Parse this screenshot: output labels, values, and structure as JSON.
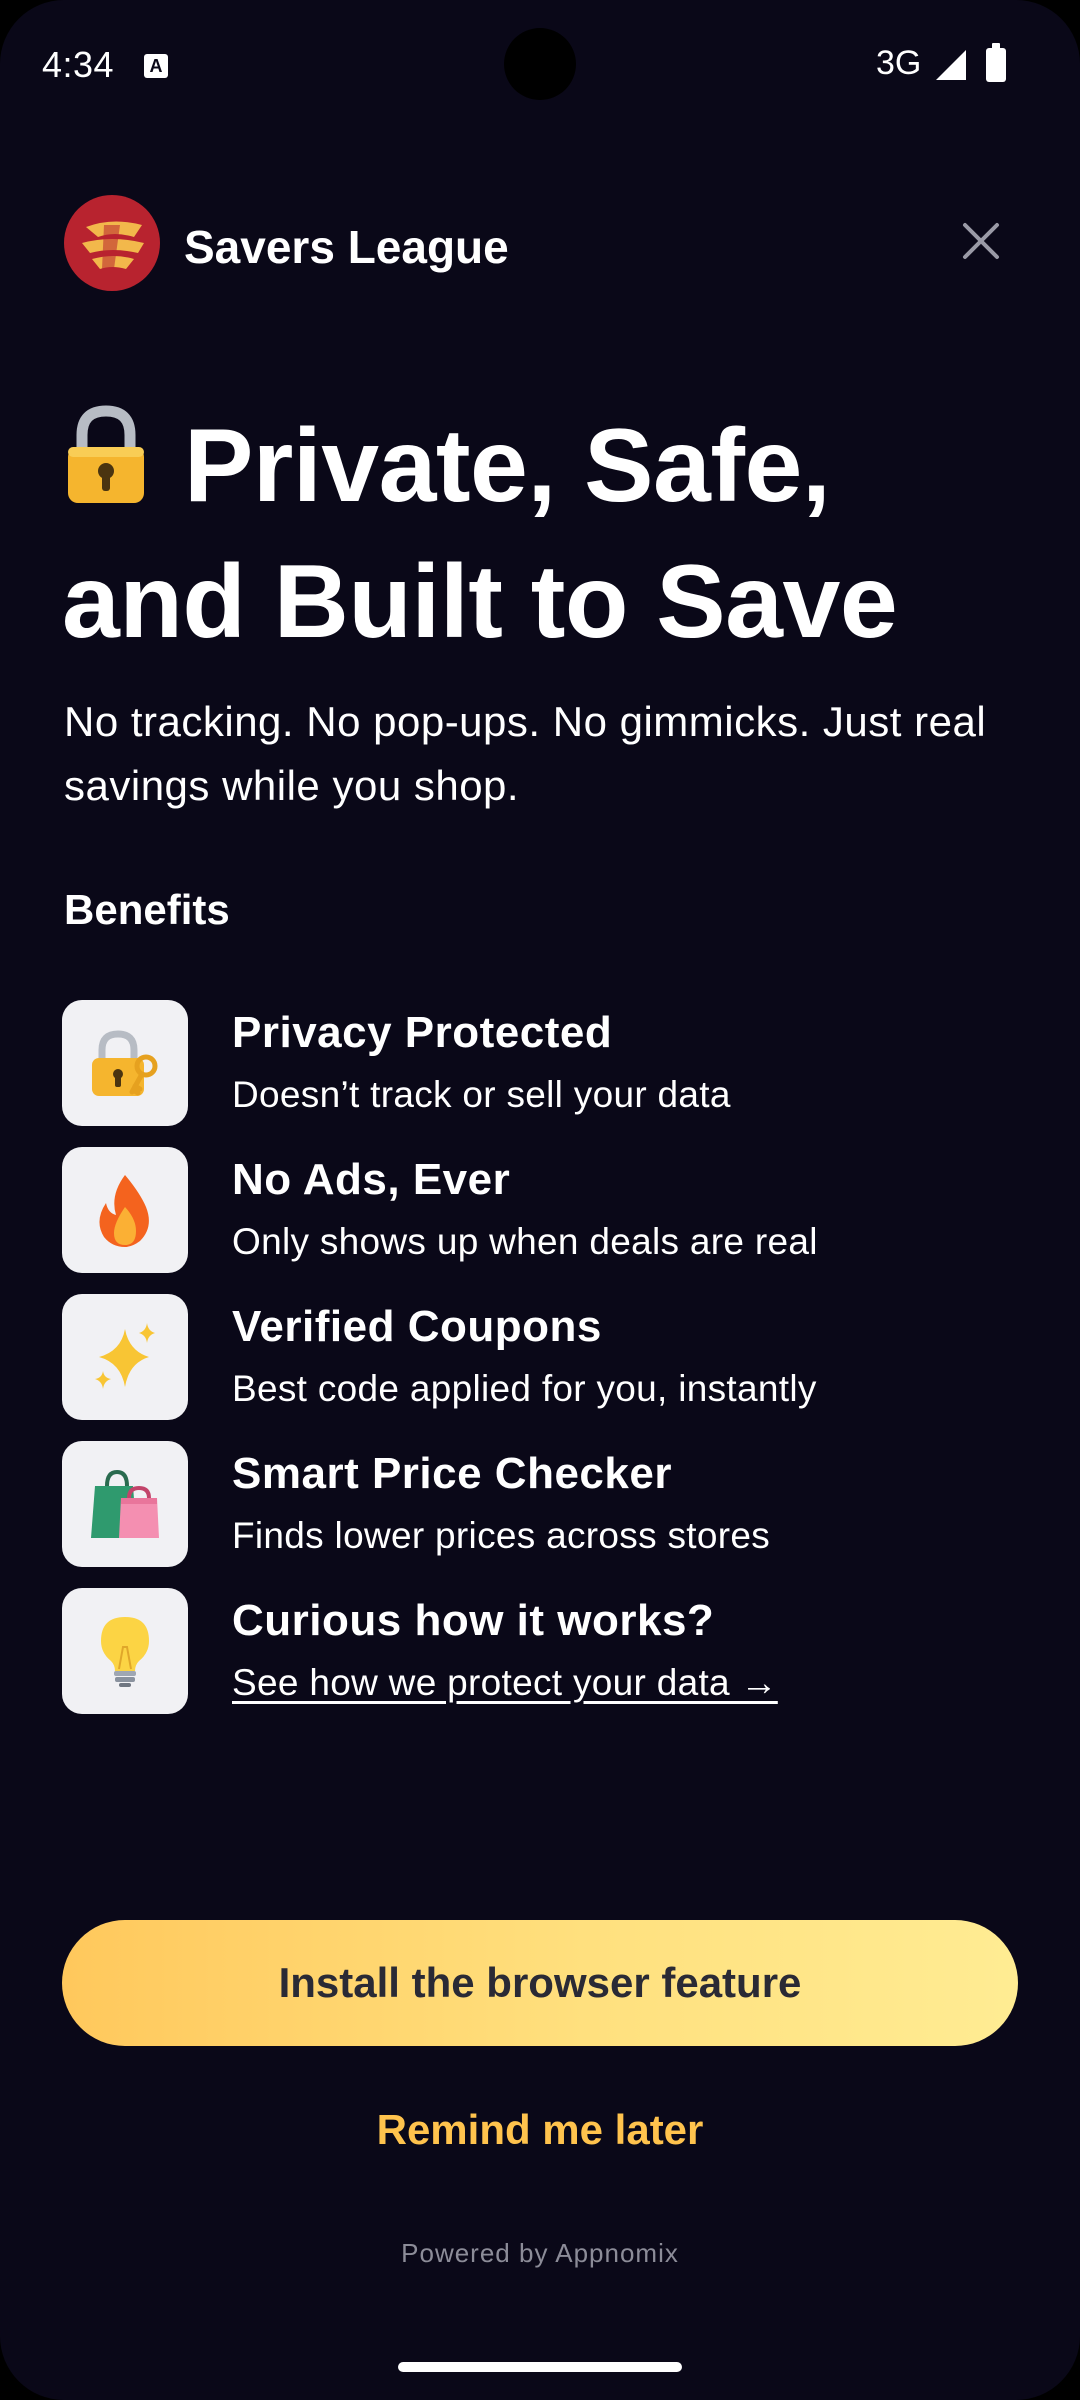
{
  "status_bar": {
    "time": "4:34",
    "network": "3G",
    "icons": [
      "keyboard-a-icon",
      "signal-icon",
      "battery-icon"
    ]
  },
  "header": {
    "brand_name": "Savers League",
    "close_icon": "close-icon"
  },
  "hero": {
    "title_emoji": "lock-icon",
    "title": "Private, Safe, and Built to Save",
    "subtitle": "No tracking. No pop-ups. No gimmicks. Just real savings while you shop."
  },
  "benefits": {
    "section_title": "Benefits",
    "items": [
      {
        "icon": "lock-with-key-icon",
        "title": "Privacy Protected",
        "description": "Doesn’t track or sell your data"
      },
      {
        "icon": "fire-icon",
        "title": "No Ads, Ever",
        "description": "Only shows up when deals are real"
      },
      {
        "icon": "sparkles-icon",
        "title": "Verified Coupons",
        "description": "Best code applied for you, instantly"
      },
      {
        "icon": "shopping-bags-icon",
        "title": "Smart Price Checker",
        "description": "Finds lower prices across stores"
      },
      {
        "icon": "light-bulb-icon",
        "title": "Curious how it works?",
        "link_text": "See how we protect your data →"
      }
    ]
  },
  "actions": {
    "install_label": "Install the browser feature",
    "remind_label": "Remind me later"
  },
  "footer": {
    "powered_by": "Powered by Appnomix"
  },
  "colors": {
    "background": "#0a0818",
    "logo_red": "#b8232f",
    "accent_yellow": "#ffc34d",
    "button_gradient_start": "#ffc85c",
    "button_gradient_end": "#ffec93"
  }
}
